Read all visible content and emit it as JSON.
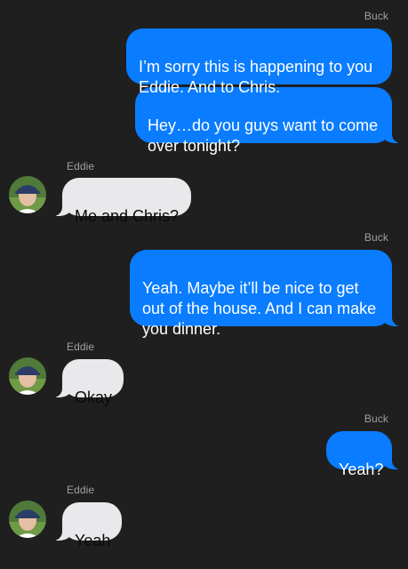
{
  "conversation": {
    "participants": {
      "me": "Buck",
      "them": "Eddie"
    },
    "messages": [
      {
        "sender": "Buck",
        "text": "I’m sorry this is happening to you\nEddie. And to Chris."
      },
      {
        "sender": "Buck",
        "text": "Hey…do you guys want to come\nover tonight?"
      },
      {
        "sender": "Eddie",
        "text": "Me and Chris?"
      },
      {
        "sender": "Buck",
        "text": "Yeah. Maybe it’ll be nice to get\nout of the house. And I can make\nyou dinner."
      },
      {
        "sender": "Eddie",
        "text": "Okay"
      },
      {
        "sender": "Buck",
        "text": "Yeah?"
      },
      {
        "sender": "Eddie",
        "text": "Yeah"
      }
    ]
  },
  "colors": {
    "background": "#1f1f1f",
    "outgoing_bubble": "#0a7cff",
    "incoming_bubble": "#e9e9eb",
    "sender_label": "#a0a0a0"
  },
  "icons": {
    "contact_avatar": "eddie-avatar-photo"
  }
}
